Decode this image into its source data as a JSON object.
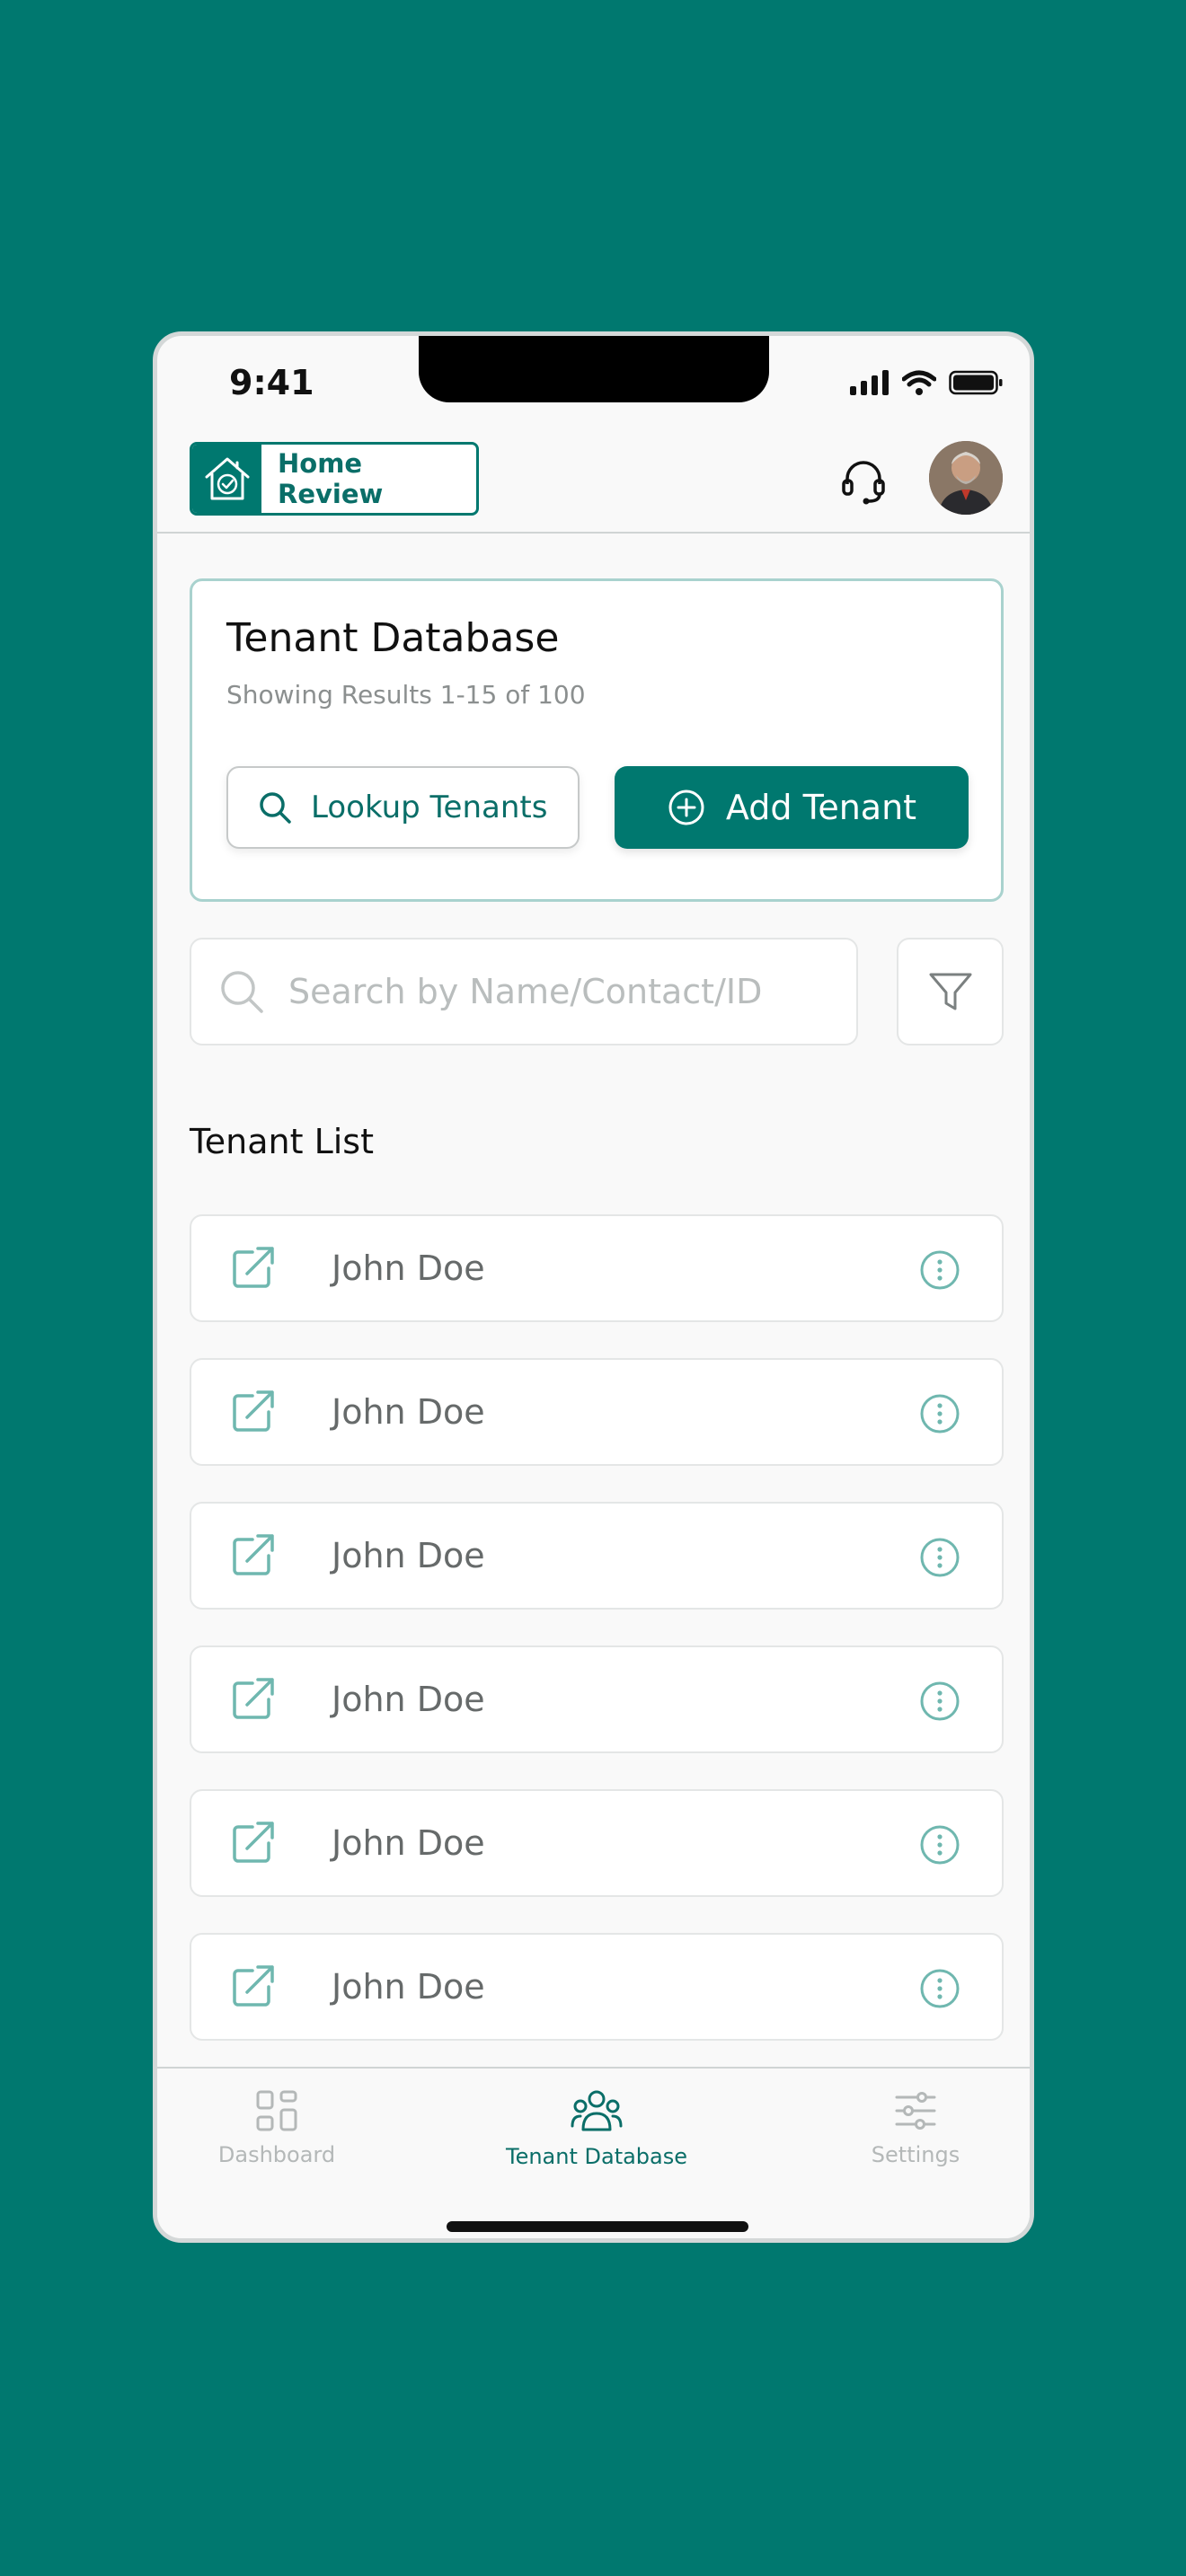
{
  "status_bar": {
    "time": "9:41"
  },
  "header": {
    "brand_name": "Home Review",
    "brand_icon": "house-check-icon",
    "support_icon": "headset-icon"
  },
  "summary": {
    "title": "Tenant Database",
    "subtitle": "Showing Results 1-15 of 100",
    "lookup_label": "Lookup Tenants",
    "add_label": "Add Tenant"
  },
  "search": {
    "placeholder": "Search by Name/Contact/ID",
    "value": ""
  },
  "list": {
    "heading": "Tenant List",
    "items": [
      {
        "name": "John Doe"
      },
      {
        "name": "John Doe"
      },
      {
        "name": "John Doe"
      },
      {
        "name": "John Doe"
      },
      {
        "name": "John Doe"
      },
      {
        "name": "John Doe"
      }
    ]
  },
  "nav": {
    "items": [
      {
        "label": "Dashboard",
        "icon": "grid-icon",
        "active": false
      },
      {
        "label": "Tenant Database",
        "icon": "users-icon",
        "active": true
      },
      {
        "label": "Settings",
        "icon": "sliders-icon",
        "active": false
      }
    ]
  },
  "colors": {
    "brand": "#00786f",
    "background": "#00786f",
    "inactive": "#b4b8b8"
  }
}
